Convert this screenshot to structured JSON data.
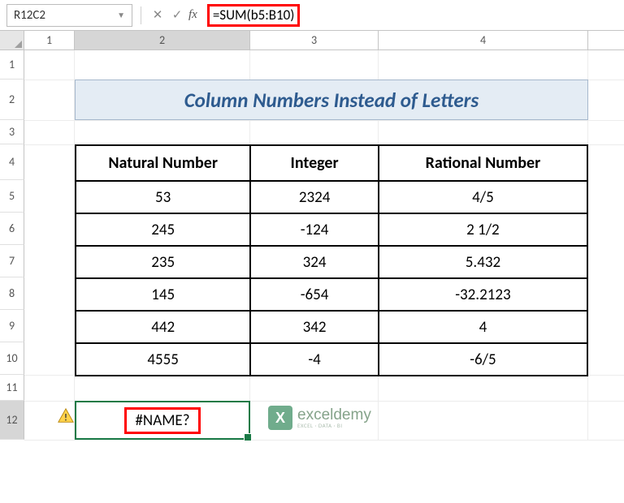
{
  "cell_reference": "R12C2",
  "formula": "=SUM(b5:B10)",
  "column_headers": [
    "1",
    "2",
    "3",
    "4"
  ],
  "row_headers": [
    "1",
    "2",
    "3",
    "4",
    "5",
    "6",
    "7",
    "8",
    "9",
    "10",
    "11",
    "12"
  ],
  "title": "Column Numbers Instead of Letters",
  "table": {
    "headers": [
      "Natural Number",
      "Integer",
      "Rational Number"
    ],
    "rows": [
      [
        "53",
        "2324",
        "4/5"
      ],
      [
        "245",
        "-124",
        "2 1/2"
      ],
      [
        "235",
        "324",
        "5.432"
      ],
      [
        "145",
        "-654",
        "-32.2123"
      ],
      [
        "442",
        "342",
        "4"
      ],
      [
        "4555",
        "-4",
        "-6/5"
      ]
    ]
  },
  "active_cell_value": "#NAME?",
  "watermark": {
    "main": "exceldemy",
    "sub": "EXCEL · DATA · BI"
  }
}
